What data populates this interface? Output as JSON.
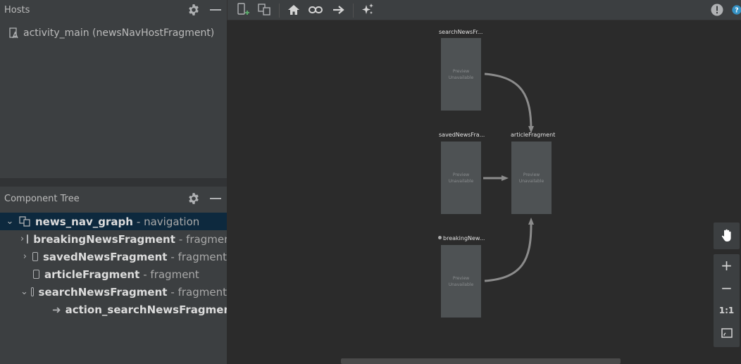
{
  "hosts": {
    "title": "Hosts",
    "item": "activity_main (newsNavHostFragment)"
  },
  "component_tree": {
    "title": "Component Tree",
    "rows": [
      {
        "name": "news_nav_graph",
        "type": "- navigation",
        "expander": "expanded",
        "icon": "nested-graph-icon"
      },
      {
        "name": "breakingNewsFragment",
        "type": "- fragment",
        "expander": "collapsed",
        "icon": "fragment-icon"
      },
      {
        "name": "savedNewsFragment",
        "type": "- fragment",
        "expander": "collapsed",
        "icon": "fragment-icon"
      },
      {
        "name": "articleFragment",
        "type": "- fragment",
        "expander": "none",
        "icon": "fragment-icon"
      },
      {
        "name": "searchNewsFragment",
        "type": "- fragment",
        "expander": "expanded",
        "icon": "fragment-icon"
      },
      {
        "name": "action_searchNewsFragment_t...",
        "type": "",
        "expander": "none",
        "icon": "action-arrow-icon"
      }
    ]
  },
  "toolbar": {
    "icons": [
      "new-destination-icon",
      "nested-graph-icon",
      "home-icon",
      "deeplink-icon",
      "action-arrow-icon",
      "auto-arrange-icon",
      "warning-icon",
      "help-icon"
    ]
  },
  "graph": {
    "nodes": [
      {
        "label": "searchNewsFr...",
        "preview_line1": "Preview",
        "preview_line2": "Unavailable"
      },
      {
        "label": "savedNewsFra...",
        "preview_line1": "Preview",
        "preview_line2": "Unavailable"
      },
      {
        "label": "articleFragment",
        "preview_line1": "Preview",
        "preview_line2": "Unavailable"
      },
      {
        "label": "breakingNew...",
        "preview_line1": "Preview",
        "preview_line2": "Unavailable"
      }
    ]
  },
  "controls": {
    "zoom_in": "+",
    "zoom_out": "−",
    "actual_size": "1:1"
  },
  "colors": {
    "selection": "#0d293e",
    "panel": "#3c3f41",
    "canvas": "#2b2b2b",
    "node": "#4e5254",
    "help": "#3592c4"
  }
}
